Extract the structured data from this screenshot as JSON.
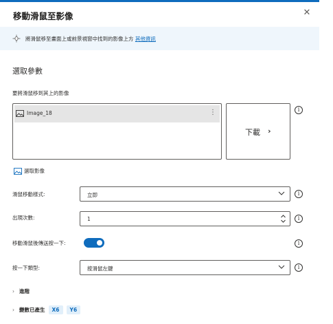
{
  "dialog": {
    "title": "移動滑鼠至影像",
    "close_icon": "close-icon"
  },
  "banner": {
    "icon": "mouse-move-icon",
    "text": "將滑鼠移至畫面上或前景視窗中找到的影像上方",
    "link": "其他資訊"
  },
  "section": {
    "title": "選取參數"
  },
  "image_field": {
    "label": "要將滑鼠移到其上的影像",
    "items": [
      {
        "name": "Image_18",
        "icon": "image-icon"
      }
    ],
    "more_label": "⋮",
    "download_label": "下載",
    "download_chevron": "›",
    "select_image_label": "選取影像"
  },
  "fields": {
    "move_style": {
      "label": "滑鼠移動樣式:",
      "value": "立即"
    },
    "occurrence": {
      "label": "出現次數:",
      "value": "1"
    },
    "send_click": {
      "label": "移動滑鼠後傳送按一下:",
      "checked": true
    },
    "click_type": {
      "label": "按一下類型:",
      "value": "按滑鼠左鍵"
    }
  },
  "expanders": {
    "advanced": {
      "label": "進階",
      "arrow": "›"
    },
    "variables": {
      "label": "變數已產生",
      "arrow": "›",
      "badges": [
        "X6",
        "Y6"
      ]
    }
  },
  "info_glyph": "i",
  "colors": {
    "accent": "#0f6cbd",
    "banner_bg": "#eff6fc",
    "badge_bg": "#e1effa"
  }
}
